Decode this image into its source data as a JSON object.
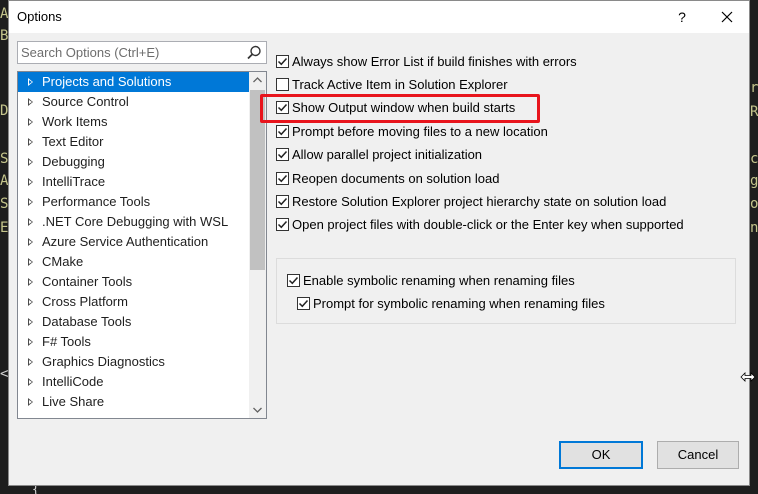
{
  "background": {
    "left_chars": [
      "A",
      "B",
      "D",
      "S",
      "A",
      "S",
      "E",
      "<"
    ],
    "right_chars": [
      "r",
      "o",
      "R",
      "c",
      "g",
      "o",
      "n"
    ],
    "bottom_brace": "{"
  },
  "dialog": {
    "title": "Options",
    "help_label": "?",
    "close_label": "✕"
  },
  "search": {
    "placeholder": "Search Options (Ctrl+E)"
  },
  "tree": {
    "items": [
      {
        "label": "Projects and Solutions",
        "selected": true
      },
      {
        "label": "Source Control"
      },
      {
        "label": "Work Items"
      },
      {
        "label": "Text Editor"
      },
      {
        "label": "Debugging"
      },
      {
        "label": "IntelliTrace"
      },
      {
        "label": "Performance Tools"
      },
      {
        "label": ".NET Core Debugging with WSL"
      },
      {
        "label": "Azure Service Authentication"
      },
      {
        "label": "CMake"
      },
      {
        "label": "Container Tools"
      },
      {
        "label": "Cross Platform"
      },
      {
        "label": "Database Tools"
      },
      {
        "label": "F# Tools"
      },
      {
        "label": "Graphics Diagnostics"
      },
      {
        "label": "IntelliCode"
      },
      {
        "label": "Live Share"
      }
    ]
  },
  "options": [
    {
      "label": "Always show Error List if build finishes with errors",
      "checked": true
    },
    {
      "label": "Track Active Item in Solution Explorer",
      "checked": false
    },
    {
      "label": "Show Output window when build starts",
      "checked": true
    },
    {
      "label": "Prompt before moving files to a new location",
      "checked": true
    },
    {
      "label": "Allow parallel project initialization",
      "checked": true
    },
    {
      "label": "Reopen documents on solution load",
      "checked": true
    },
    {
      "label": "Restore Solution Explorer project hierarchy state on solution load",
      "checked": true
    },
    {
      "label": "Open project files with double-click or the Enter key when supported",
      "checked": true
    }
  ],
  "renaming": {
    "enable_label": "Enable symbolic renaming when renaming files",
    "enable_checked": true,
    "prompt_label": "Prompt for symbolic renaming when renaming files",
    "prompt_checked": true
  },
  "buttons": {
    "ok": "OK",
    "cancel": "Cancel"
  },
  "colors": {
    "selection": "#0078d7",
    "highlight_border": "#e8141c",
    "dialog_bg": "#f0f0f0"
  }
}
